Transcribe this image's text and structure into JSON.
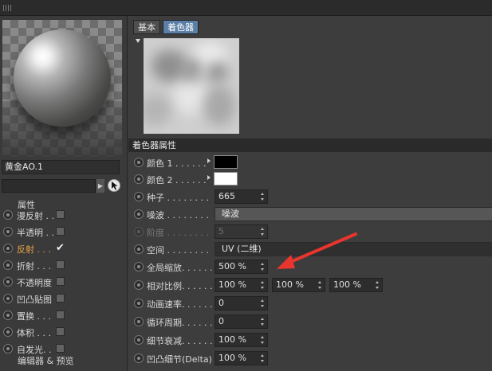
{
  "material": {
    "name": "黄金AO.1",
    "channels_header": "属性",
    "channels": [
      {
        "label": "漫反射 . .",
        "active": false,
        "checked": false
      },
      {
        "label": "半透明 . .",
        "active": false,
        "checked": false
      },
      {
        "label": "反射 . . .",
        "active": true,
        "checked": true
      },
      {
        "label": "折射 . . .",
        "active": false,
        "checked": false
      },
      {
        "label": "不透明度",
        "active": false,
        "checked": false
      },
      {
        "label": "凹凸贴图",
        "active": false,
        "checked": false
      },
      {
        "label": "置换 . . .",
        "active": false,
        "checked": false
      },
      {
        "label": "体积 . . .",
        "active": false,
        "checked": false
      },
      {
        "label": "自发光. .",
        "active": false,
        "checked": false
      }
    ],
    "editor_label": "编辑器 & 预览"
  },
  "tabs": [
    {
      "label": "基本",
      "active": false
    },
    {
      "label": "着色器",
      "active": true
    }
  ],
  "section_title": "着色器属性",
  "properties": {
    "color1": {
      "label": "颜色 1 . . . . . .",
      "value": "#000000"
    },
    "color2": {
      "label": "颜色 2 . . . . . .",
      "value": "#ffffff"
    },
    "seed": {
      "label": "种子 . . . . . . . .",
      "value": "665"
    },
    "noise": {
      "label": "噪波 . . . . . . . .",
      "value": "噪波"
    },
    "octaves": {
      "label": "阶度 . . . . . . . .",
      "value": "5"
    },
    "space": {
      "label": "空间 . . . . . . . .",
      "value": "UV (二维)"
    },
    "global_scale": {
      "label": "全局缩放. . . . . .",
      "value": "500 %"
    },
    "relative_scale": {
      "label": "相对比例. . . . . .",
      "values": [
        "100 %",
        "100 %",
        "100 %"
      ]
    },
    "anim_speed": {
      "label": "动画速率. . . . . .",
      "value": "0"
    },
    "loop_period": {
      "label": "循环周期. . . . . .",
      "value": "0"
    },
    "detail_atten": {
      "label": "细节衰减. . . . . .",
      "value": "100 %"
    },
    "delta": {
      "label": "凹凸细节(Delta)",
      "value": "100 %"
    }
  },
  "annotation": {
    "color": "#e8352d"
  }
}
